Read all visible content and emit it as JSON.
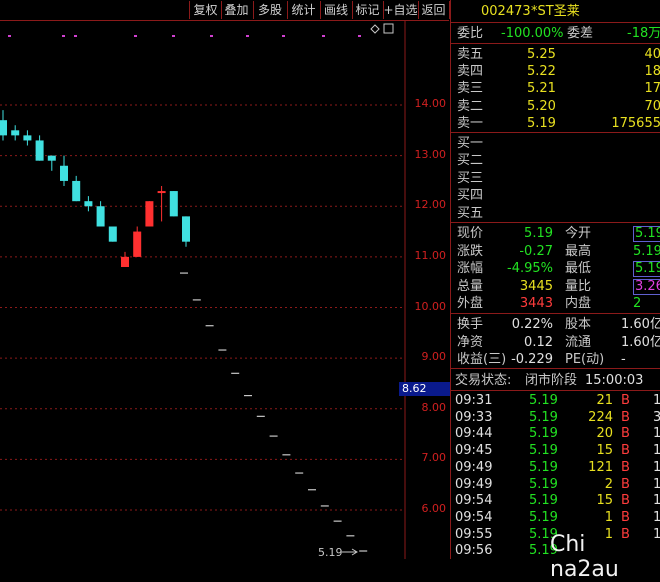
{
  "toolbar": {
    "buttons": [
      "复权",
      "叠加",
      "多股",
      "统计",
      "画线",
      "标记",
      "+自选",
      "返回"
    ]
  },
  "chart": {
    "y_ticks": [
      "14.00",
      "13.00",
      "12.00",
      "11.00",
      "10.00",
      "9.00",
      "8.00",
      "7.00",
      "6.00"
    ],
    "current_price_flag": "8.62",
    "last_price_label": "5.19",
    "colors": {
      "up": "#ff3030",
      "down": "#40e0e0",
      "grid": "#8b1a1a",
      "dash": "#c8c8c8"
    },
    "candles": [
      {
        "o": 13.7,
        "h": 13.9,
        "l": 13.3,
        "c": 13.4
      },
      {
        "o": 13.5,
        "h": 13.6,
        "l": 13.3,
        "c": 13.4
      },
      {
        "o": 13.4,
        "h": 13.5,
        "l": 13.2,
        "c": 13.3
      },
      {
        "o": 13.3,
        "h": 13.4,
        "l": 12.9,
        "c": 12.9
      },
      {
        "o": 13.0,
        "h": 13.0,
        "l": 12.7,
        "c": 12.9
      },
      {
        "o": 12.8,
        "h": 13.0,
        "l": 12.4,
        "c": 12.5
      },
      {
        "o": 12.5,
        "h": 12.6,
        "l": 12.1,
        "c": 12.1
      },
      {
        "o": 12.1,
        "h": 12.2,
        "l": 11.9,
        "c": 12.0
      },
      {
        "o": 12.0,
        "h": 12.1,
        "l": 11.6,
        "c": 11.6
      },
      {
        "o": 11.6,
        "h": 11.6,
        "l": 11.3,
        "c": 11.3
      },
      {
        "o": 10.8,
        "h": 11.1,
        "l": 10.8,
        "c": 11.0
      },
      {
        "o": 11.0,
        "h": 11.6,
        "l": 11.0,
        "c": 11.5
      },
      {
        "o": 11.6,
        "h": 12.1,
        "l": 11.6,
        "c": 12.1
      },
      {
        "o": 12.3,
        "h": 12.4,
        "l": 11.7,
        "c": 12.3
      },
      {
        "o": 12.3,
        "h": 12.3,
        "l": 11.8,
        "c": 11.8
      },
      {
        "o": 11.8,
        "h": 11.8,
        "l": 11.2,
        "c": 11.3
      }
    ],
    "limit_down": [
      10.68,
      10.15,
      9.64,
      9.16,
      8.7,
      8.26,
      7.85,
      7.46,
      7.09,
      6.73,
      6.4,
      6.08,
      5.78,
      5.49,
      5.19
    ]
  },
  "quote": {
    "code": "002473",
    "name": "*ST圣莱",
    "weibi_label": "委比",
    "weibi_value": "-100.00%",
    "weicha_label": "委差",
    "weicha_value": "-18万",
    "sell": [
      {
        "label": "卖五",
        "price": "5.25",
        "vol": "40"
      },
      {
        "label": "卖四",
        "price": "5.22",
        "vol": "18"
      },
      {
        "label": "卖三",
        "price": "5.21",
        "vol": "17"
      },
      {
        "label": "卖二",
        "price": "5.20",
        "vol": "70"
      },
      {
        "label": "卖一",
        "price": "5.19",
        "vol": "175655"
      }
    ],
    "buy": [
      {
        "label": "买一"
      },
      {
        "label": "买二"
      },
      {
        "label": "买三"
      },
      {
        "label": "买四"
      },
      {
        "label": "买五"
      }
    ],
    "stats": [
      {
        "l1": "现价",
        "v1": "5.19",
        "c1": "green",
        "l2": "今开",
        "v2": "5.19",
        "c2": "green",
        "box": true
      },
      {
        "l1": "涨跌",
        "v1": "-0.27",
        "c1": "green",
        "l2": "最高",
        "v2": "5.19",
        "c2": "green"
      },
      {
        "l1": "涨幅",
        "v1": "-4.95%",
        "c1": "green",
        "l2": "最低",
        "v2": "5.19",
        "c2": "green",
        "box": true
      },
      {
        "l1": "总量",
        "v1": "3445",
        "c1": "yellow",
        "l2": "量比",
        "v2": "3.26",
        "c2": "magenta",
        "box": true
      },
      {
        "l1": "外盘",
        "v1": "3443",
        "c1": "red",
        "l2": "内盘",
        "v2": "2",
        "c2": "green"
      }
    ],
    "fund": [
      {
        "l1": "换手",
        "v1": "0.22%",
        "l2": "股本",
        "v2": "1.60亿"
      },
      {
        "l1": "净资",
        "v1": "0.12",
        "l2": "流通",
        "v2": "1.60亿"
      },
      {
        "l1": "收益(三)",
        "v1": "-0.229",
        "l2": "PE(动)",
        "v2": "-"
      }
    ],
    "status_label": "交易状态:",
    "status_value": "闭市阶段",
    "status_time": "15:00:03"
  },
  "ticks": [
    {
      "time": "09:31",
      "price": "5.19",
      "vol": "21",
      "side": "B",
      "n": "1"
    },
    {
      "time": "09:33",
      "price": "5.19",
      "vol": "224",
      "side": "B",
      "n": "3"
    },
    {
      "time": "09:44",
      "price": "5.19",
      "vol": "20",
      "side": "B",
      "n": "1"
    },
    {
      "time": "09:45",
      "price": "5.19",
      "vol": "15",
      "side": "B",
      "n": "1"
    },
    {
      "time": "09:49",
      "price": "5.19",
      "vol": "121",
      "side": "B",
      "n": "1"
    },
    {
      "time": "09:49",
      "price": "5.19",
      "vol": "2",
      "side": "B",
      "n": "1"
    },
    {
      "time": "09:54",
      "price": "5.19",
      "vol": "15",
      "side": "B",
      "n": "1"
    },
    {
      "time": "09:54",
      "price": "5.19",
      "vol": "1",
      "side": "B",
      "n": "1"
    },
    {
      "time": "09:55",
      "price": "5.19",
      "vol": "1",
      "side": "B",
      "n": "1"
    },
    {
      "time": "09:56",
      "price": "5.19",
      "vol": "",
      "side": "",
      "n": ""
    }
  ],
  "watermark": "Chi na2au"
}
